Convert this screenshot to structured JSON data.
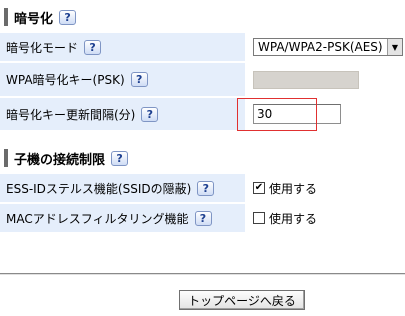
{
  "encryption": {
    "title": "暗号化",
    "help": "?",
    "mode_label": "暗号化モード",
    "mode_value": "WPA/WPA2-PSK(AES)",
    "psk_label": "WPA暗号化キー(PSK)",
    "interval_label": "暗号化キー更新間隔(分)",
    "interval_value": "30"
  },
  "client_restriction": {
    "title": "子機の接続制限",
    "help": "?",
    "stealth_label": "ESS-IDステルス機能(SSIDの隠蔽)",
    "stealth_check_label": "使用する",
    "stealth_checked": true,
    "mac_label": "MACアドレスフィルタリング機能",
    "mac_check_label": "使用する",
    "mac_checked": false
  },
  "footer": {
    "back_button": "トップページへ戻る"
  },
  "colors": {
    "label_bg": "#e5eefb",
    "highlight": "#e03030"
  },
  "icons": {
    "help": "help-icon",
    "dropdown": "chevron-down-icon",
    "check": "check-icon"
  }
}
